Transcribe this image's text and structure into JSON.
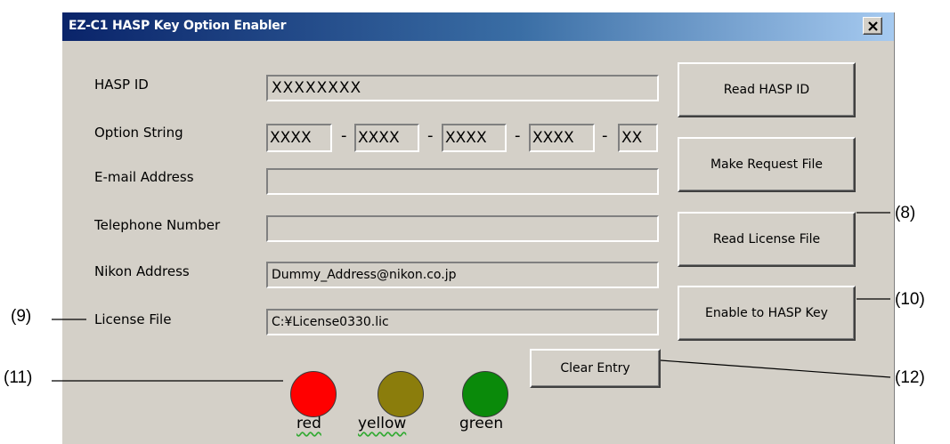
{
  "window": {
    "title": "EZ-C1 HASP Key Option Enabler"
  },
  "form": {
    "hasp_id_label": "HASP ID",
    "hasp_id_value": "XXXXXXXX",
    "option_string_label": "Option String",
    "option_segments": [
      "XXXX",
      "XXXX",
      "XXXX",
      "XXXX",
      "XX"
    ],
    "option_separator": "-",
    "email_label": "E-mail Address",
    "email_value": "",
    "phone_label": "Telephone Number",
    "phone_value": "",
    "nikon_address_label": "Nikon Address",
    "nikon_address_value": "Dummy_Address@nikon.co.jp",
    "license_file_label": "License File",
    "license_file_value": "C:¥License0330.lic"
  },
  "buttons": {
    "read_hasp_id": "Read HASP ID",
    "make_request_file": "Make Request File",
    "read_license_file": "Read License File",
    "enable_to_hasp_key": "Enable to HASP Key",
    "clear_entry": "Clear Entry"
  },
  "status_lights": [
    {
      "label": "red",
      "color": "#ff0000"
    },
    {
      "label": "yellow",
      "color": "#8b7d0c"
    },
    {
      "label": "green",
      "color": "#0a8a0a"
    }
  ],
  "callouts": {
    "c8": "(8)",
    "c9": "(9)",
    "c10": "(10)",
    "c11": "(11)",
    "c12": "(12)"
  }
}
